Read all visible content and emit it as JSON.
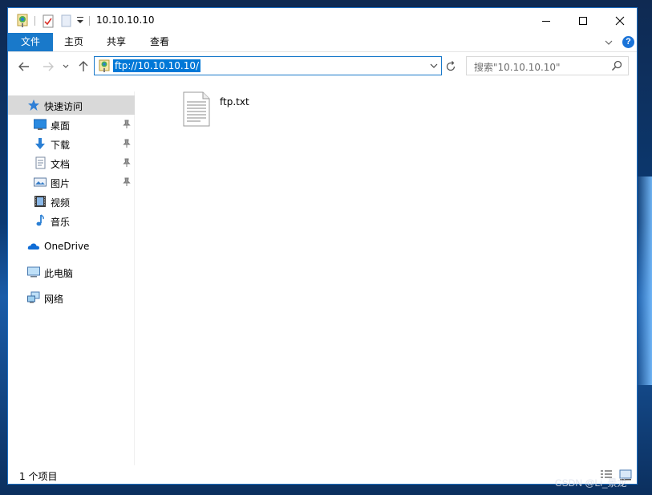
{
  "window": {
    "title": "10.10.10.10",
    "ribbon_tabs": [
      "文件",
      "主页",
      "共享",
      "查看"
    ],
    "help_glyph": "?"
  },
  "navigation": {
    "address": "ftp://10.10.10.10/",
    "search_placeholder": "搜索\"10.10.10.10\""
  },
  "sidebar": {
    "items": [
      {
        "label": "快速访问",
        "icon": "star-icon",
        "pinned": false
      },
      {
        "label": "桌面",
        "icon": "desktop-icon",
        "pinned": true
      },
      {
        "label": "下载",
        "icon": "download-icon",
        "pinned": true
      },
      {
        "label": "文档",
        "icon": "document-icon",
        "pinned": true
      },
      {
        "label": "图片",
        "icon": "pictures-icon",
        "pinned": true
      },
      {
        "label": "视频",
        "icon": "video-icon",
        "pinned": false
      },
      {
        "label": "音乐",
        "icon": "music-icon",
        "pinned": false
      },
      {
        "label": "OneDrive",
        "icon": "onedrive-icon",
        "pinned": false
      },
      {
        "label": "此电脑",
        "icon": "this-pc-icon",
        "pinned": false
      },
      {
        "label": "网络",
        "icon": "network-icon",
        "pinned": false
      }
    ]
  },
  "files": [
    {
      "name": "ftp.txt",
      "icon": "text-file-icon"
    }
  ],
  "status": {
    "item_count": "1 个项目"
  },
  "watermark": "CSDN @Li_景龙",
  "colors": {
    "accent": "#1979ca",
    "selection": "#0078d7",
    "sidebar_selected": "#d9d9d9"
  }
}
